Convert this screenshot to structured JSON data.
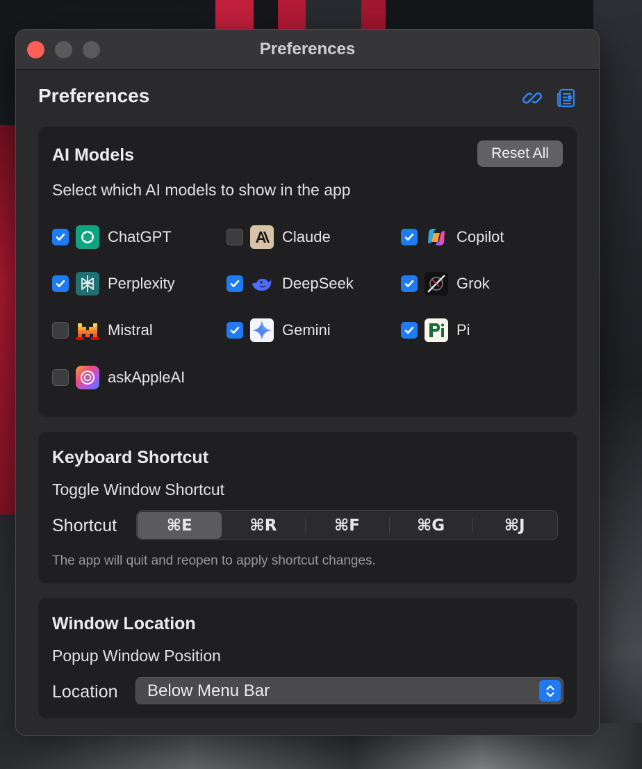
{
  "window": {
    "title": "Preferences"
  },
  "page": {
    "title": "Preferences",
    "header_icons": [
      "link-icon",
      "document-icon"
    ]
  },
  "ai_models": {
    "title": "AI Models",
    "reset_label": "Reset All",
    "subtitle": "Select which AI models to show in the app",
    "items": [
      {
        "label": "ChatGPT",
        "checked": true,
        "icon": "chatgpt-logo"
      },
      {
        "label": "Claude",
        "checked": false,
        "icon": "claude-logo"
      },
      {
        "label": "Copilot",
        "checked": true,
        "icon": "copilot-logo"
      },
      {
        "label": "Perplexity",
        "checked": true,
        "icon": "perplexity-logo"
      },
      {
        "label": "DeepSeek",
        "checked": true,
        "icon": "deepseek-logo"
      },
      {
        "label": "Grok",
        "checked": true,
        "icon": "grok-logo"
      },
      {
        "label": "Mistral",
        "checked": false,
        "icon": "mistral-logo"
      },
      {
        "label": "Gemini",
        "checked": true,
        "icon": "gemini-logo"
      },
      {
        "label": "Pi",
        "checked": true,
        "icon": "pi-logo"
      },
      {
        "label": "askAppleAI",
        "checked": false,
        "icon": "askappleai-logo"
      }
    ]
  },
  "keyboard_shortcut": {
    "title": "Keyboard Shortcut",
    "subtitle": "Toggle Window Shortcut",
    "label": "Shortcut",
    "options": [
      "⌘E",
      "⌘R",
      "⌘F",
      "⌘G",
      "⌘J"
    ],
    "selected": "⌘E",
    "hint": "The app will quit and reopen to apply shortcut changes."
  },
  "window_location": {
    "title": "Window Location",
    "subtitle": "Popup Window Position",
    "label": "Location",
    "selected": "Below Menu Bar"
  },
  "colors": {
    "accent": "#1f7bf2",
    "close": "#ff5f57",
    "window_bg": "#2a2a2c",
    "section_bg": "#1f1f21"
  }
}
